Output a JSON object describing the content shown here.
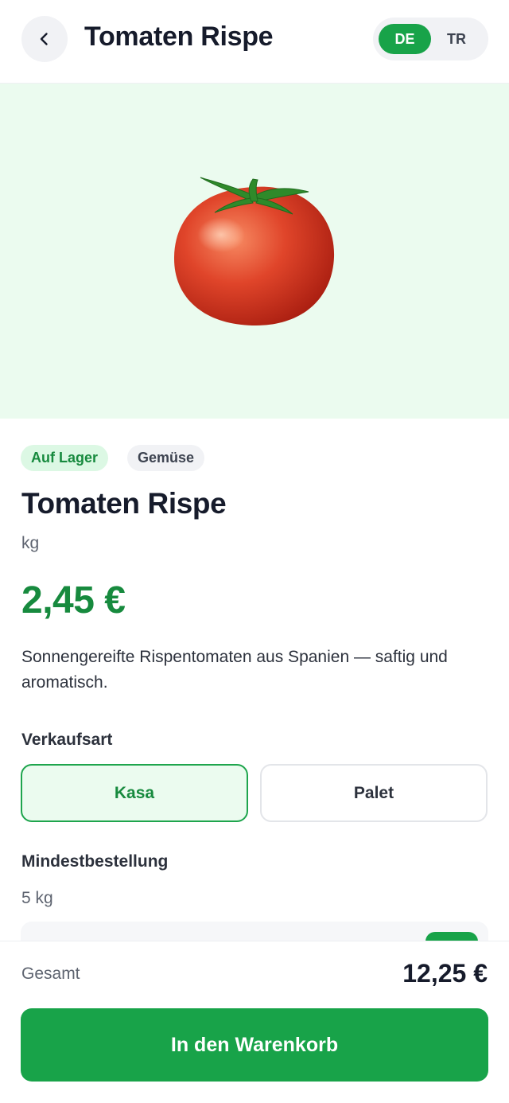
{
  "header": {
    "back_icon": "chevron-left-icon",
    "title": "Tomaten Rispe",
    "languages": [
      {
        "code": "DE",
        "active": true
      },
      {
        "code": "TR",
        "active": false
      }
    ]
  },
  "hero": {
    "image": "tomato",
    "background": "#ebfbef"
  },
  "product": {
    "badges": {
      "stock": "Auf Lager",
      "category": "Gemüse"
    },
    "name": "Tomaten Rispe",
    "unit": "kg",
    "price": "2,45 €",
    "description": "Sonnengereifte Rispentomaten aus Spanien — saftig und aromatisch."
  },
  "sale_type": {
    "label": "Verkaufsart",
    "options": [
      {
        "label": "Kasa",
        "selected": true
      },
      {
        "label": "Palet",
        "selected": false
      }
    ]
  },
  "minimum_order": {
    "label": "Mindestbestellung",
    "value": "5 kg"
  },
  "footer": {
    "total_label": "Gesamt",
    "total_value": "12,25 €",
    "cart_button": "In den Warenkorb"
  },
  "colors": {
    "accent": "#18a349",
    "price": "#178a3e",
    "text": "#161b2b"
  }
}
